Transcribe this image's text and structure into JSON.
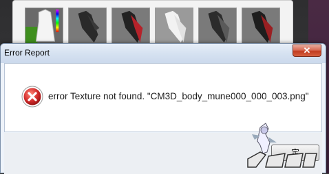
{
  "dialog": {
    "title": "Error Report",
    "close_label": "✕",
    "message": "error Texture not found. \"CM3D_body_mune000_000_003.png\"",
    "icon": "error-icon",
    "ok_label": "定"
  },
  "palette": {
    "thumbnails": [
      "dress-white",
      "jacket-black",
      "jacket-red",
      "jacket-white",
      "jacket-grey",
      "jacket-red-dark"
    ]
  },
  "colors": {
    "title_gradient_top": "#e7eef8",
    "close_red": "#c23b1f",
    "error_red": "#d22b2b"
  }
}
